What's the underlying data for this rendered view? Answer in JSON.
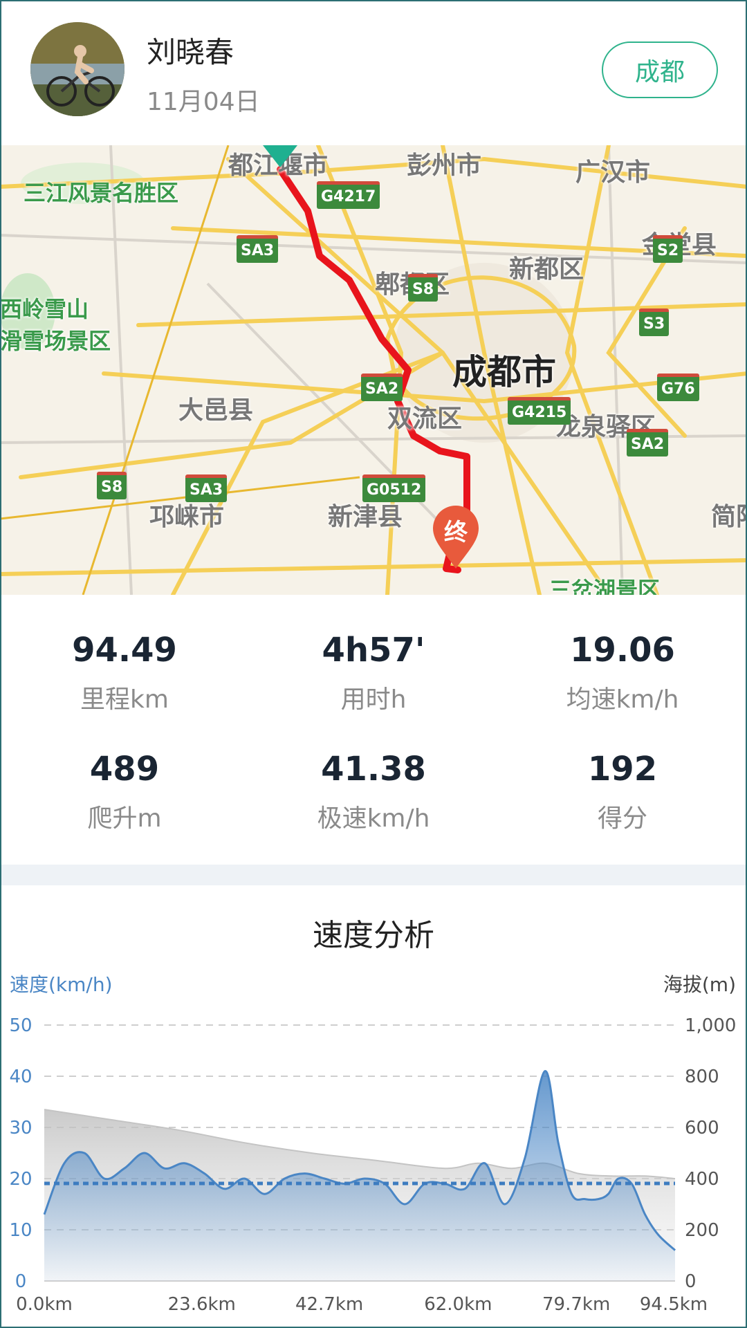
{
  "header": {
    "user_name": "刘晓春",
    "date": "11月04日",
    "city_button": "成都",
    "avatar_icon": "cyclist-avatar-icon"
  },
  "map": {
    "labels": {
      "dujiangyan": "都江堰市",
      "pengzhou": "彭州市",
      "guanghan": "广汉市",
      "sanjiang": "三江风景名胜区",
      "jintang": "金堂县",
      "xindu": "新都区",
      "pidu": "郫都区",
      "chengdu": "成都市",
      "xiling1": "西岭雪山",
      "xiling2": "滑雪场景区",
      "dayi": "大邑县",
      "shuangliu": "双流区",
      "longquanyi": "龙泉驿区",
      "qionglai": "邛崃市",
      "xinjin": "新津县",
      "jian": "简阳",
      "sancha": "三岔湖景区"
    },
    "shields": {
      "g4217": "G4217",
      "sa3a": "SA3",
      "s2": "S2",
      "s8a": "S8",
      "s3": "S3",
      "sa2a": "SA2",
      "g76": "G76",
      "g4215": "G4215",
      "sa2b": "SA2",
      "s8b": "S8",
      "sa3b": "SA3",
      "g0512": "G0512"
    },
    "start_marker_icon": "start-triangle-icon",
    "end_marker_icon": "end-pin-icon",
    "end_marker_text": "终",
    "route_color": "#e8141c"
  },
  "stats": [
    {
      "value": "94.49",
      "label": "里程km"
    },
    {
      "value": "4h57'",
      "label": "用时h"
    },
    {
      "value": "19.06",
      "label": "均速km/h"
    },
    {
      "value": "489",
      "label": "爬升m"
    },
    {
      "value": "41.38",
      "label": "极速km/h"
    },
    {
      "value": "192",
      "label": "得分"
    }
  ],
  "chart": {
    "title": "速度分析",
    "left_axis_title": "速度(km/h)",
    "right_axis_title": "海拔(m)"
  },
  "chart_data": {
    "type": "area",
    "x_ticks": [
      "0.0km",
      "23.6km",
      "42.7km",
      "62.0km",
      "79.7km",
      "94.5km"
    ],
    "xlim": [
      0,
      94.5
    ],
    "y_left_ticks": [
      "0",
      "10",
      "20",
      "30",
      "40",
      "50"
    ],
    "ylim_left": [
      0,
      50
    ],
    "y_right_ticks": [
      "0",
      "200",
      "400",
      "600",
      "800",
      "1,000"
    ],
    "ylim_right": [
      0,
      1000
    ],
    "average_speed": 19.06,
    "grid": true,
    "series": [
      {
        "axis": "left",
        "color": "#4a86c5",
        "x": [
          0,
          3,
          6,
          9,
          12,
          15,
          18,
          21,
          24,
          27,
          30,
          33,
          36,
          39,
          42,
          45,
          48,
          51,
          54,
          57,
          60,
          63,
          66,
          69,
          72,
          75,
          77,
          79,
          81,
          83,
          84.5,
          86,
          88,
          90,
          92,
          94.5
        ],
        "values": [
          13,
          23,
          25,
          20,
          22,
          25,
          22,
          23,
          21,
          18,
          20,
          17,
          20,
          21,
          20,
          19,
          20,
          19,
          15,
          19,
          19,
          18,
          23,
          15,
          24,
          41,
          27,
          17,
          16,
          16,
          17,
          20,
          19,
          13,
          9,
          6
        ]
      },
      {
        "axis": "right",
        "color": "#c8c8c8",
        "x": [
          0,
          10,
          20,
          30,
          40,
          50,
          60,
          65,
          70,
          75,
          80,
          85,
          90,
          94.5
        ],
        "values": [
          670,
          630,
          590,
          540,
          500,
          470,
          440,
          460,
          440,
          460,
          420,
          410,
          410,
          400
        ]
      }
    ]
  }
}
